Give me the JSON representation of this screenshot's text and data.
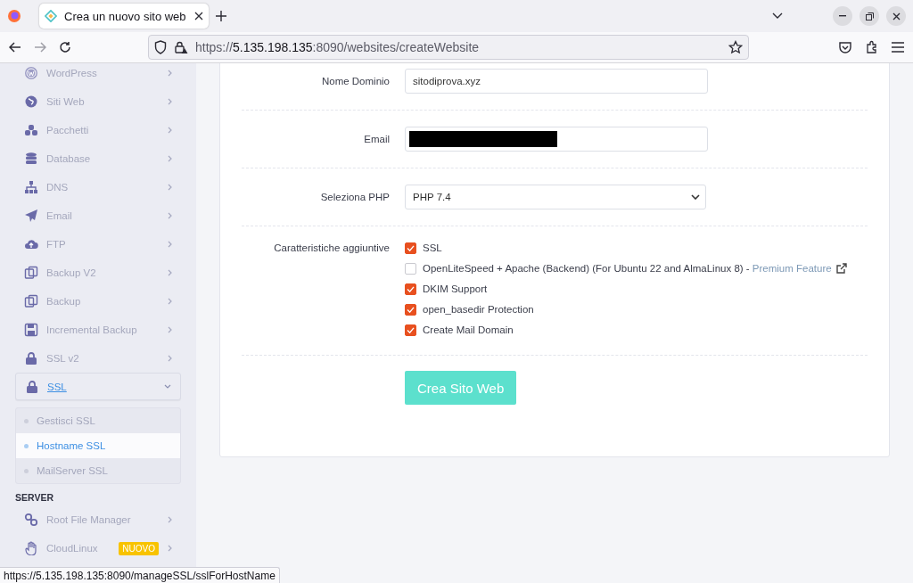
{
  "browser": {
    "tab_title": "Crea un nuovo sito web",
    "url": {
      "scheme": "https://",
      "host": "5.135.198.135",
      "path": ":8090/websites/createWebsite"
    }
  },
  "sidebar": {
    "items": [
      {
        "label": "WordPress",
        "expanded": false
      },
      {
        "label": "Siti Web",
        "expanded": false
      },
      {
        "label": "Pacchetti",
        "expanded": false
      },
      {
        "label": "Database",
        "expanded": false
      },
      {
        "label": "DNS",
        "expanded": false
      },
      {
        "label": "Email",
        "expanded": false
      },
      {
        "label": "FTP",
        "expanded": false
      },
      {
        "label": "Backup V2",
        "expanded": false
      },
      {
        "label": "Backup",
        "expanded": false
      },
      {
        "label": "Incremental Backup",
        "expanded": false
      },
      {
        "label": "SSL v2",
        "expanded": false
      },
      {
        "label": "SSL",
        "expanded": true,
        "children": [
          {
            "label": "Gestisci SSL",
            "selected": false
          },
          {
            "label": "Hostname SSL",
            "selected": true
          },
          {
            "label": "MailServer SSL",
            "selected": false
          }
        ]
      }
    ],
    "section": "SERVER",
    "server_items": [
      {
        "label": "Root File Manager"
      },
      {
        "label": "CloudLinux",
        "badge": "NUOVO"
      }
    ]
  },
  "form": {
    "fields": [
      {
        "kind": "text",
        "label": "Nome Dominio",
        "value": "sitodiprova.xyz"
      },
      {
        "kind": "redacted",
        "label": "Email"
      },
      {
        "kind": "select",
        "label": "Seleziona PHP",
        "value": "PHP 7.4"
      }
    ],
    "features_label": "Caratteristiche aggiuntive",
    "features": [
      {
        "label": "SSL",
        "checked": true
      },
      {
        "label": "OpenLiteSpeed + Apache (Backend) (For Ubuntu 22 and AlmaLinux 8) -",
        "link": "Premium Feature",
        "checked": false
      },
      {
        "label": "DKIM Support",
        "checked": true
      },
      {
        "label": "open_basedir Protection",
        "checked": true
      },
      {
        "label": "Create Mail Domain",
        "checked": true
      }
    ],
    "submit": "Crea Sito Web"
  },
  "status_url": "https://5.135.198.135:8090/manageSSL/sslForHostName"
}
